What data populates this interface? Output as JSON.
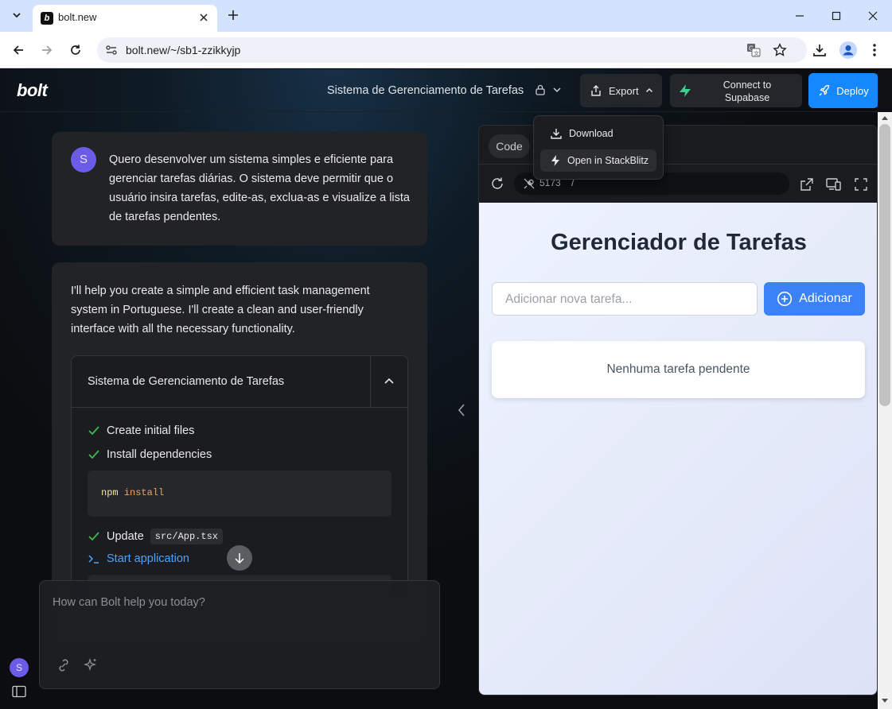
{
  "browser": {
    "tab_title": "bolt.new",
    "url": "bolt.new/~/sb1-zzikkyjp"
  },
  "app": {
    "logo": "bolt",
    "project_title": "Sistema de Gerenciamento de Tarefas",
    "export_label": "Export",
    "supabase_label": "Connect to Supabase",
    "deploy_label": "Deploy",
    "export_menu": {
      "download": "Download",
      "stackblitz": "Open in StackBlitz"
    }
  },
  "chat": {
    "user_initial": "S",
    "user_message": "Quero desenvolver um sistema simples e eficiente para gerenciar tarefas diárias. O sistema deve permitir que o usuário insira tarefas, edite-as, exclua-as e visualize a lista de tarefas pendentes.",
    "ai_message": "I'll help you create a simple and efficient task management system in Portuguese. I'll create a clean and user-friendly interface with all the necessary functionality.",
    "artifact": {
      "title": "Sistema de Gerenciamento de Tarefas",
      "steps": {
        "s1": "Create initial files",
        "s2": "Install dependencies",
        "s3": "Update",
        "s3_path": "src/App.tsx",
        "s4": "Start application"
      },
      "code": {
        "cmd": "npm",
        "arg": "install"
      }
    },
    "input_placeholder": "How can Bolt help you today?"
  },
  "workbench": {
    "code_tab": "Code",
    "port": "5173",
    "path": "/",
    "preview": {
      "title": "Gerenciador de Tarefas",
      "input_placeholder": "Adicionar nova tarefa...",
      "add_label": "Adicionar",
      "empty_message": "Nenhuma tarefa pendente"
    }
  },
  "colors": {
    "accent": "#1488fc",
    "preview_button": "#3b82f6",
    "avatar": "#6b5ce7",
    "check": "#3fb950"
  }
}
